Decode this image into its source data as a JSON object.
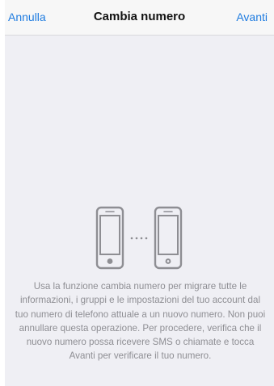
{
  "navbar": {
    "cancel_label": "Annulla",
    "title": "Cambia numero",
    "next_label": "Avanti"
  },
  "illustration": {
    "icon": "phone-transfer-icon",
    "separator": "• • • •"
  },
  "description": "Usa la funzione cambia numero per migrare tutte le informazioni, i gruppi e le impostazioni del tuo account dal tuo numero di telefono attuale a un nuovo numero. Non puoi annullare questa operazione. Per procedere, verifica che il nuovo numero possa ricevere SMS o chiamate e tocca Avanti per verificare il tuo numero.",
  "colors": {
    "accent": "#1f7ce0",
    "background": "#efeff4",
    "navbar": "#f7f7f7",
    "text_secondary": "#8e8e93",
    "icon": "#8e8e93"
  }
}
